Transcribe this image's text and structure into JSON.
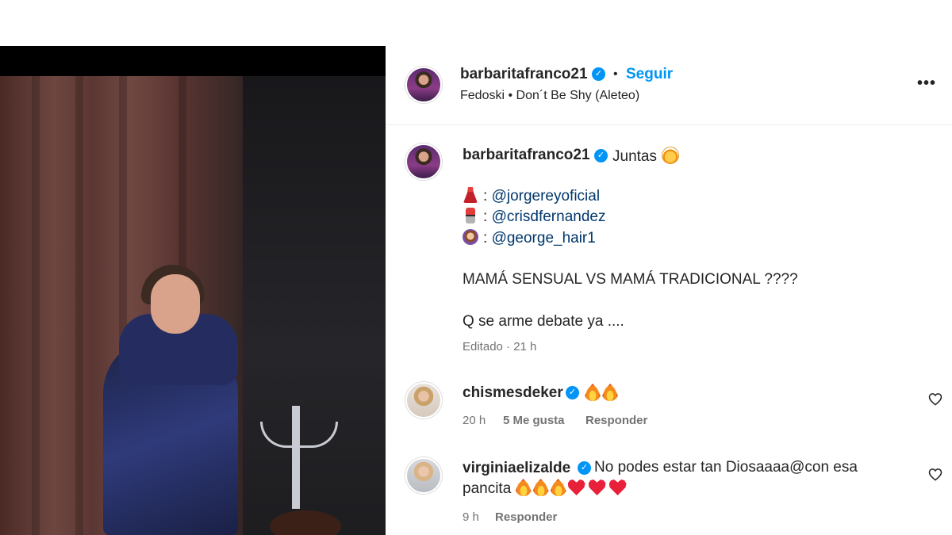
{
  "post": {
    "author": "barbaritafranco21",
    "verified_icon": "verified-badge-icon",
    "separator": "•",
    "follow_label": "Seguir",
    "audio": "Fedoski • Don´t Be Shy (Aleteo)",
    "more_label": "•••"
  },
  "caption": {
    "author": "barbaritafranco21",
    "first_line": "Juntas",
    "credits": [
      {
        "emoji": "dress-emoji",
        "prefix": ":",
        "mention": "@jorgereyoficial"
      },
      {
        "emoji": "lipstick-emoji",
        "prefix": ":",
        "mention": "@crisdfernandez"
      },
      {
        "emoji": "haircut-emoji",
        "prefix": ":",
        "mention": "@george_hair1"
      }
    ],
    "line_question": "MAMÁ SENSUAL VS MAMÁ TRADICIONAL ????",
    "line_debate": "Q se arme debate ya ....",
    "edited_meta": "Editado · 21 h"
  },
  "comments": [
    {
      "user": "chismesdeker",
      "text": "",
      "emojis": [
        "fire",
        "fire"
      ],
      "time": "20 h",
      "likes": "5 Me gusta",
      "reply_label": "Responder"
    },
    {
      "user": "virginiaelizalde",
      "text_line1": "No podes estar tan Diosaaaa@con esa",
      "text_line2": "pancita",
      "emojis": [
        "fire",
        "fire",
        "fire",
        "heart",
        "heart",
        "heart"
      ],
      "time": "9 h",
      "reply_label": "Responder"
    }
  ],
  "colors": {
    "accent": "#0095f6",
    "text": "#262626",
    "muted": "#737373",
    "mention": "#00376b",
    "heart": "#e8203a"
  }
}
